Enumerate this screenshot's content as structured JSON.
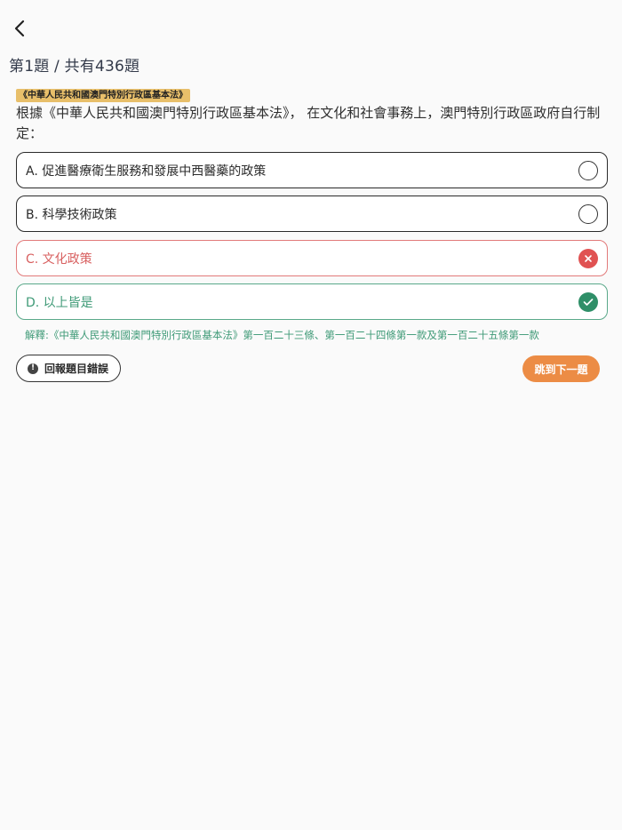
{
  "header": {
    "title": "第1題 / 共有436題"
  },
  "question": {
    "category": "《中華人民共和國澳門特別行政區基本法》",
    "text": "根據《中華人民共和國澳門特別行政區基本法》， 在文化和社會事務上，澳門特別行政區政府自行制定："
  },
  "options": [
    {
      "label": "A. 促進醫療衛生服務和發展中西醫藥的政策",
      "state": "unselected"
    },
    {
      "label": "B. 科學技術政策",
      "state": "unselected"
    },
    {
      "label": "C. 文化政策",
      "state": "wrong"
    },
    {
      "label": "D. 以上皆是",
      "state": "correct"
    }
  ],
  "explanation": "解釋:《中華人民共和國澳門特別行政區基本法》第一百二十三條、第一百二十四條第一款及第一百二十五條第一款",
  "actions": {
    "report_label": "回報題目錯誤",
    "next_label": "跳到下一題"
  },
  "colors": {
    "wrong": "#e05252",
    "correct": "#2f8f68",
    "accent": "#ec8c45",
    "tag": "#e8bf6a"
  }
}
